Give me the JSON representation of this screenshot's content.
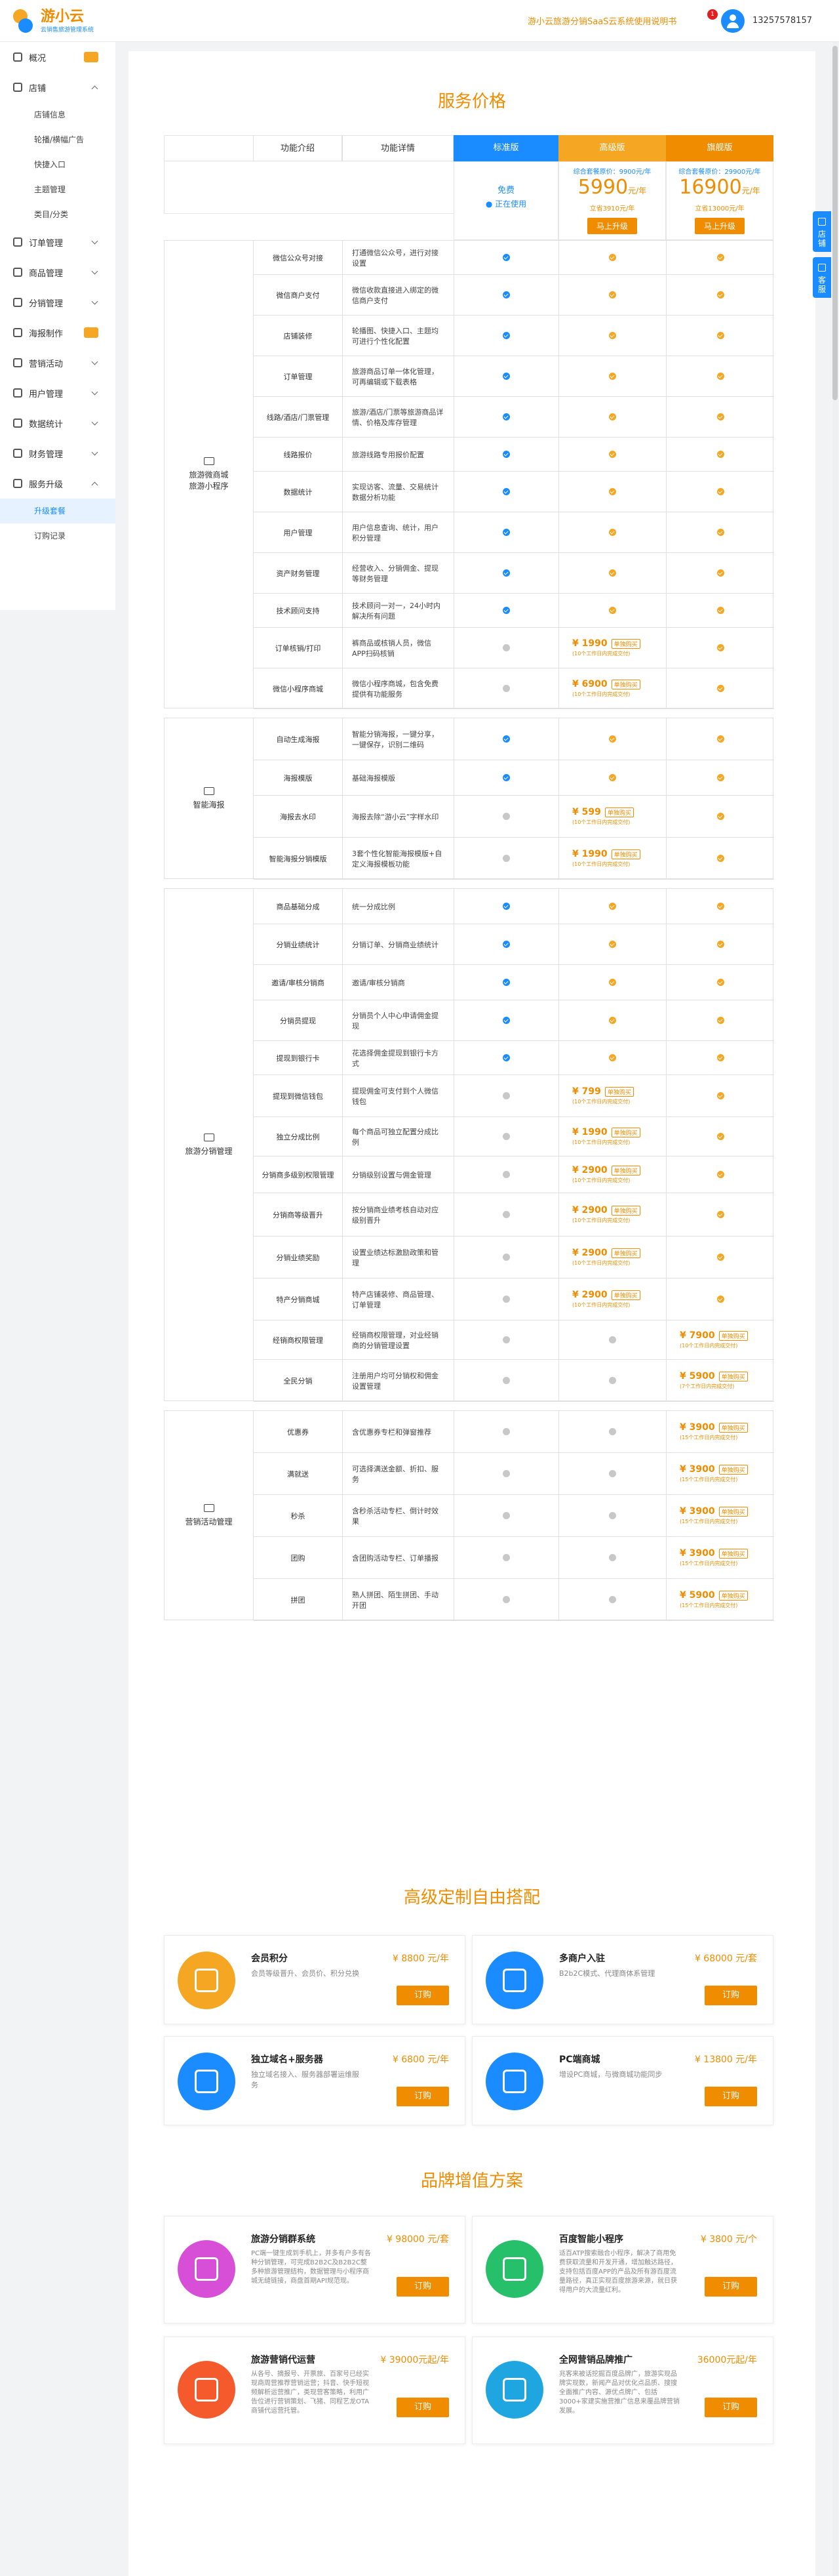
{
  "header": {
    "logo_title": "游小云",
    "logo_sub": "云销售旅游管理系统",
    "notice": "游小云旅游分销SaaS云系统使用说明书",
    "notice_badge": "1",
    "user_phone": "13257578157"
  },
  "sidebar": {
    "items": [
      {
        "label": "概况",
        "icon": "dashboard-icon",
        "hot": true
      },
      {
        "label": "店铺",
        "icon": "store-icon",
        "expanded": true,
        "children": [
          "店铺信息",
          "轮播/横幅广告",
          "快捷入口",
          "主题管理",
          "类目/分类"
        ]
      },
      {
        "label": "订单管理",
        "icon": "order-icon"
      },
      {
        "label": "商品管理",
        "icon": "goods-icon"
      },
      {
        "label": "分销管理",
        "icon": "distribution-icon"
      },
      {
        "label": "海报制作",
        "icon": "poster-icon",
        "hot": true
      },
      {
        "label": "营销活动",
        "icon": "marketing-icon"
      },
      {
        "label": "用户管理",
        "icon": "users-icon"
      },
      {
        "label": "数据统计",
        "icon": "chart-icon"
      },
      {
        "label": "财务管理",
        "icon": "finance-icon"
      },
      {
        "label": "服务升级",
        "icon": "upgrade-icon",
        "expanded": true,
        "children": [
          "升级套餐",
          "订购记录"
        ]
      }
    ],
    "active_child": "升级套餐"
  },
  "pricing": {
    "title": "服务价格",
    "headers": {
      "intro": "功能介绍",
      "detail": "功能详情",
      "std": "标准版",
      "adv": "高级版",
      "flag": "旗舰版"
    },
    "plans": {
      "std": {
        "free": "免费",
        "status": "正在使用"
      },
      "adv": {
        "small": "综合套餐原价：9900元/年",
        "price": "5990",
        "unit": "元/年",
        "orig": "立省3910元/年",
        "button": "马上升级"
      },
      "flag": {
        "small": "综合套餐原价：29900元/年",
        "price": "16900",
        "unit": "元/年",
        "orig": "立省13000元/年",
        "button": "马上升级"
      }
    },
    "groups": [
      {
        "name": "旅游微商城\n旅游小程序",
        "rows": [
          {
            "intro": "微信公众号对接",
            "detail": "打通微信公众号，进行对接设置",
            "std": "blue",
            "adv": "orange",
            "flag": "orange"
          },
          {
            "intro": "微信商户支付",
            "detail": "微信收款直接进入绑定的微信商户支付",
            "std": "blue",
            "adv": "orange",
            "flag": "orange"
          },
          {
            "intro": "店铺装修",
            "detail": "轮播图、快捷入口、主题均可进行个性化配置",
            "std": "blue",
            "adv": "orange",
            "flag": "orange"
          },
          {
            "intro": "订单管理",
            "detail": "旅游商品订单一体化管理，可再编辑或下载表格",
            "std": "blue",
            "adv": "orange",
            "flag": "orange"
          },
          {
            "intro": "线路/酒店/门票管理",
            "detail": "旅游/酒店/门票等旅游商品详情、价格及库存管理",
            "std": "blue",
            "adv": "orange",
            "flag": "orange"
          },
          {
            "intro": "线路报价",
            "detail": "旅游线路专用报价配置",
            "std": "blue",
            "adv": "orange",
            "flag": "orange"
          },
          {
            "intro": "数据统计",
            "detail": "实现访客、流量、交易统计数据分析功能",
            "std": "blue",
            "adv": "orange",
            "flag": "orange"
          },
          {
            "intro": "用户管理",
            "detail": "用户信息查询、统计，用户积分管理",
            "std": "blue",
            "adv": "orange",
            "flag": "orange"
          },
          {
            "intro": "资产财务管理",
            "detail": "经营收入、分销佣金、提现等财务管理",
            "std": "blue",
            "adv": "orange",
            "flag": "orange"
          },
          {
            "intro": "技术顾问支持",
            "detail": "技术顾问一对一，24小时内解决所有问题",
            "std": "blue",
            "adv": "orange",
            "flag": "orange"
          },
          {
            "intro": "订单核销/打印",
            "detail": "裤商品或核销人员，微信APP扫码核销",
            "std": "gray",
            "adv": {
              "price": "¥ 1990",
              "badge": "单独购买",
              "note": "(10个工作日内完成交付)"
            },
            "flag": "orange"
          },
          {
            "intro": "微信小程序商城",
            "detail": "微信小程序商城，包含免费提供有功能服务",
            "std": "gray",
            "adv": {
              "price": "¥ 6900",
              "badge": "单独购买",
              "note": "(10个工作日内完成交付)"
            },
            "flag": "orange"
          }
        ]
      },
      {
        "name": "智能海报",
        "rows": [
          {
            "intro": "自动生成海报",
            "detail": "智能分销海报，一键分享，一键保存，识别二维码",
            "std": "blue",
            "adv": "orange",
            "flag": "orange"
          },
          {
            "intro": "海报模版",
            "detail": "基础海报模版",
            "std": "blue",
            "adv": "orange",
            "flag": "orange"
          },
          {
            "intro": "海报去水印",
            "detail": "海报去除“游小云”字样水印",
            "std": "gray",
            "adv": {
              "price": "¥ 599",
              "badge": "单独购买",
              "note": "(10个工作日内完成交付)"
            },
            "flag": "orange"
          },
          {
            "intro": "智能海报分销模版",
            "detail": "3套个性化智能海报模版+自定义海报模板功能",
            "std": "gray",
            "adv": {
              "price": "¥ 1990",
              "badge": "单独购买",
              "note": "(10个工作日内完成交付)"
            },
            "flag": "orange"
          }
        ]
      },
      {
        "name": "旅游分销管理",
        "rows": [
          {
            "intro": "商品基础分成",
            "detail": "统一分成比例",
            "std": "blue",
            "adv": "orange",
            "flag": "orange"
          },
          {
            "intro": "分销业绩统计",
            "detail": "分销订单、分销商业绩统计",
            "std": "blue",
            "adv": "orange",
            "flag": "orange"
          },
          {
            "intro": "邀请/审核分销商",
            "detail": "邀请/审核分销商",
            "std": "blue",
            "adv": "orange",
            "flag": "orange"
          },
          {
            "intro": "分销员提现",
            "detail": "分销员个人中心申请佣金提现",
            "std": "blue",
            "adv": "orange",
            "flag": "orange"
          },
          {
            "intro": "提现到银行卡",
            "detail": "花选择佣金提现到银行卡方式",
            "std": "blue",
            "adv": "orange",
            "flag": "orange"
          },
          {
            "intro": "提现到微信钱包",
            "detail": "提现佣金可支付到个人微信钱包",
            "std": "gray",
            "adv": {
              "price": "¥ 799",
              "badge": "单独购买",
              "note": "(10个工作日内完成交付)"
            },
            "flag": "orange"
          },
          {
            "intro": "独立分成比例",
            "detail": "每个商品可独立配置分成比例",
            "std": "gray",
            "adv": {
              "price": "¥ 1990",
              "badge": "单独购买",
              "note": "(10个工作日内完成交付)"
            },
            "flag": "orange"
          },
          {
            "intro": "分销商多级别权限管理",
            "detail": "分销级别设置与佣金管理",
            "std": "gray",
            "adv": {
              "price": "¥ 2900",
              "badge": "单独购买",
              "note": "(10个工作日内完成交付)"
            },
            "flag": "orange"
          },
          {
            "intro": "分销商等级晋升",
            "detail": "按分销商业绩考核自动对应级别晋升",
            "std": "gray",
            "adv": {
              "price": "¥ 2900",
              "badge": "单独购买",
              "note": "(10个工作日内完成交付)"
            },
            "flag": "orange"
          },
          {
            "intro": "分销业绩奖励",
            "detail": "设置业绩达标激励政策和管理",
            "std": "gray",
            "adv": {
              "price": "¥ 2900",
              "badge": "单独购买",
              "note": "(10个工作日内完成交付)"
            },
            "flag": "orange"
          },
          {
            "intro": "特产分销商城",
            "detail": "特产店铺装修、商品管理、订单管理",
            "std": "gray",
            "adv": {
              "price": "¥ 2900",
              "badge": "单独购买",
              "note": "(10个工作日内完成交付)"
            },
            "flag": "orange"
          },
          {
            "intro": "经销商权限管理",
            "detail": "经销商权限管理，对业经销商的分销管理设置",
            "std": "gray",
            "adv": "gray",
            "flag": {
              "price": "¥ 7900",
              "badge": "单独购买",
              "note": "(10个工作日内完成交付)"
            }
          },
          {
            "intro": "全民分销",
            "detail": "注册用户均可分销权和佣金设置管理",
            "std": "gray",
            "adv": "gray",
            "flag": {
              "price": "¥ 5900",
              "badge": "单独购买",
              "note": "(7个工作日内完成交付)"
            }
          }
        ]
      },
      {
        "name": "营销活动管理",
        "rows": [
          {
            "intro": "优惠券",
            "detail": "含优惠券专栏和弹窗推荐",
            "std": "gray",
            "adv": "gray",
            "flag": {
              "price": "¥ 3900",
              "badge": "单独购买",
              "note": "(15个工作日内完成交付)"
            }
          },
          {
            "intro": "满就送",
            "detail": "可选择满送金额、折扣、服务",
            "std": "gray",
            "adv": "gray",
            "flag": {
              "price": "¥ 3900",
              "badge": "单独购买",
              "note": "(15个工作日内完成交付)"
            }
          },
          {
            "intro": "秒杀",
            "detail": "含秒杀活动专栏、倒计时效果",
            "std": "gray",
            "adv": "gray",
            "flag": {
              "price": "¥ 3900",
              "badge": "单独购买",
              "note": "(15个工作日内完成交付)"
            }
          },
          {
            "intro": "团购",
            "detail": "含团购活动专栏、订单播报",
            "std": "gray",
            "adv": "gray",
            "flag": {
              "price": "¥ 3900",
              "badge": "单独购买",
              "note": "(15个工作日内完成交付)"
            }
          },
          {
            "intro": "拼团",
            "detail": "熟人拼团、陌生拼团、手动开团",
            "std": "gray",
            "adv": "gray",
            "flag": {
              "price": "¥ 5900",
              "badge": "单独购买",
              "note": "(15个工作日内完成交付)"
            }
          }
        ]
      }
    ]
  },
  "custom": {
    "title": "高级定制自由搭配",
    "cards": [
      {
        "title": "会员积分",
        "price": "¥ 8800 元/年",
        "desc": "会员等级晋升、会员价、积分兑换",
        "button": "订购",
        "color": "#f5a623",
        "icon": "crown-icon"
      },
      {
        "title": "多商户入驻",
        "price": "¥ 68000 元/套",
        "desc": "B2b2C模式、代理商体系管理",
        "button": "订购",
        "color": "#1a8cff",
        "icon": "store-icon"
      },
      {
        "title": "独立域名+服务器",
        "price": "¥ 6800 元/年",
        "desc": "独立域名接入、服务器部署运维服务",
        "button": "订购",
        "color": "#1a8cff",
        "icon": "www-icon"
      },
      {
        "title": "PC端商城",
        "price": "¥ 13800 元/年",
        "desc": "增设PC商城，与微商城功能同步",
        "button": "订购",
        "color": "#1a8cff",
        "icon": "monitor-icon"
      }
    ]
  },
  "brand": {
    "title": "品牌增值方案",
    "cards": [
      {
        "title": "旅游分销群系统",
        "price": "¥ 98000 元/套",
        "desc": "PC端一键生成到手机上，并多有户多有各种分销管理，可完成B2B2C及B2B2C整多种旅游管理结构，数据管理与小程序商城无缝链接，商盘首期API规范现。",
        "button": "订购",
        "color": "#d64fd6",
        "icon": "system-icon"
      },
      {
        "title": "百度智能小程序",
        "price": "¥ 3800 元/个",
        "desc": "适百ATP搜索融合小程序，解决了商用免费获取流量和开发开通，增加触达路径，支持包括百度APP的产品及所有游百度流量路径，真正实现百度旅游来源，就日获得用户的大流量红利。",
        "button": "订购",
        "color": "#27c06a",
        "icon": "link-icon"
      },
      {
        "title": "旅游营销代运营",
        "price": "¥ 39000元起/年",
        "desc": "从各号、摘报号、开票旅、百家号已经实现商周营推荐营销运营；抖音、快手短视频解析运营推广，类现营客策略，利用广告位进行营销策划、飞猪、同程艺龙OTA商铺代运营托管。",
        "button": "订购",
        "color": "#f55a2c",
        "icon": "share-icon"
      },
      {
        "title": "全网营销品牌推广",
        "price": "36000元起/年",
        "desc": "兆客来被话挖掘百度品牌广，旅游实现品牌实现数，新闻产品对优化点品质、搜搜全面推广内容、源优点牌广、包括3000+家建实施营推广信息来覆品牌营销发展。",
        "button": "订购",
        "color": "#1fa6e0",
        "icon": "megaphone-icon"
      }
    ]
  },
  "float_tabs": [
    {
      "label": "店铺",
      "icon": "store-icon"
    },
    {
      "label": "客服",
      "icon": "headset-icon"
    }
  ]
}
